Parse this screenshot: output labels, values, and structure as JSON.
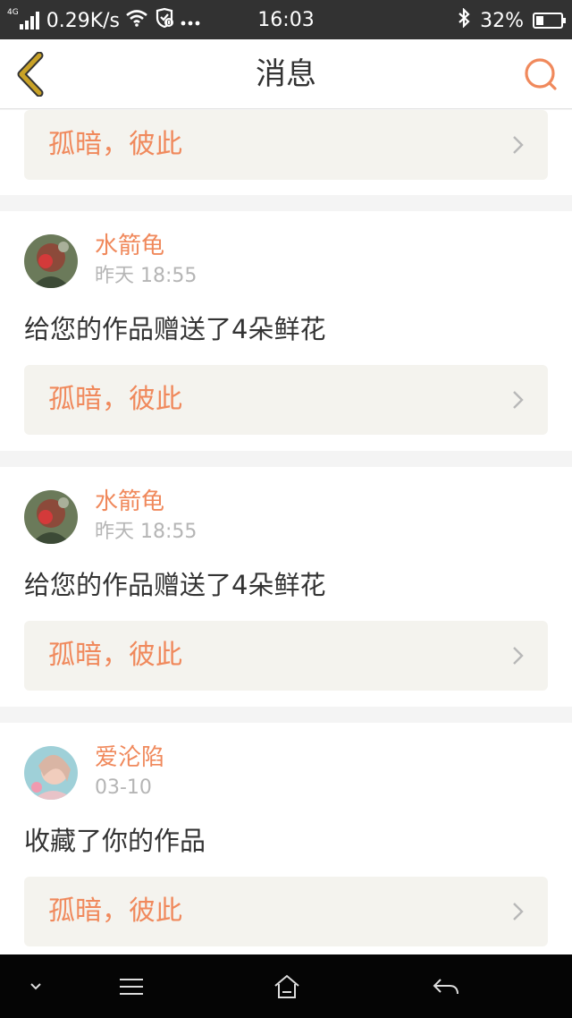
{
  "status_bar": {
    "network_type": "4G",
    "speed": "0.29K/s",
    "time": "16:03",
    "battery_pct": "32%",
    "battery_level": 0.32,
    "icons": [
      "signal-icon",
      "wifi-icon",
      "shield-icon",
      "more-dots-icon",
      "bluetooth-icon",
      "battery-icon"
    ]
  },
  "header": {
    "title": "消息",
    "back_icon": "back-chevron-icon",
    "search_icon": "search-icon",
    "accent": "#f0895c"
  },
  "feed": {
    "top_partial_card": {
      "work_title": "孤暗，彼此"
    },
    "items": [
      {
        "username": "水箭龟",
        "time": "昨天 18:55",
        "message": "给您的作品赠送了4朵鲜花",
        "work_title": "孤暗，彼此"
      },
      {
        "username": "水箭龟",
        "time": "昨天 18:55",
        "message": "给您的作品赠送了4朵鲜花",
        "work_title": "孤暗，彼此"
      },
      {
        "username": "爱沦陷",
        "time": "03-10",
        "message": "收藏了你的作品",
        "work_title": "孤暗，彼此"
      }
    ]
  },
  "nav_bar": {
    "icons": [
      "collapse-down-icon",
      "menu-icon",
      "home-icon",
      "back-arrow-icon"
    ]
  },
  "colors": {
    "accent": "#f0895c",
    "link_bg": "#f4f3ee",
    "status_bar_bg": "#323232",
    "nav_bar_bg": "#050505",
    "back_icon": "#c9a227"
  }
}
